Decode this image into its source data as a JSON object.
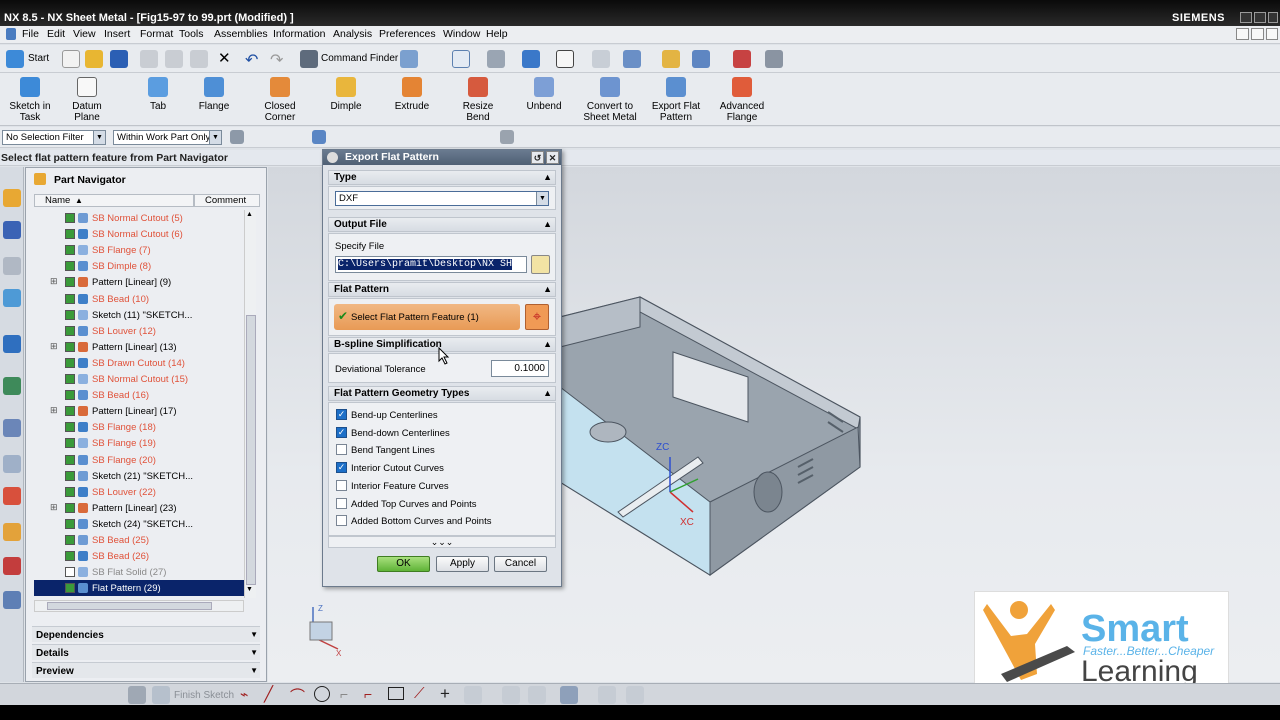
{
  "window": {
    "title": "NX 8.5 - NX Sheet Metal - [Fig15-97 to 99.prt (Modified) ]",
    "brand": "SIEMENS"
  },
  "menu": [
    "File",
    "Edit",
    "View",
    "Insert",
    "Format",
    "Tools",
    "Assemblies",
    "Information",
    "Analysis",
    "Preferences",
    "Window",
    "Help"
  ],
  "toolbar": {
    "start_label": "Start",
    "command_finder_label": "Command Finder"
  },
  "ribbon": [
    {
      "label": "Sketch in Task",
      "icon": "sketch-icon"
    },
    {
      "label": "Datum Plane",
      "icon": "datum-plane-icon"
    },
    {
      "label": "Tab",
      "icon": "tab-icon"
    },
    {
      "label": "Flange",
      "icon": "flange-icon"
    },
    {
      "label": "Closed Corner",
      "icon": "closed-corner-icon"
    },
    {
      "label": "Dimple",
      "icon": "dimple-icon"
    },
    {
      "label": "Extrude",
      "icon": "extrude-icon"
    },
    {
      "label": "Resize Bend",
      "icon": "resize-bend-icon"
    },
    {
      "label": "Unbend",
      "icon": "unbend-icon"
    },
    {
      "label": "Convert to Sheet Metal",
      "icon": "convert-icon"
    },
    {
      "label": "Export Flat Pattern",
      "icon": "export-flat-icon"
    },
    {
      "label": "Advanced Flange",
      "icon": "advanced-flange-icon"
    }
  ],
  "filters": {
    "selection_filter": "No Selection Filter",
    "scope": "Within Work Part Only"
  },
  "cue_line": "Select flat pattern feature from Part Navigator",
  "navigator": {
    "title": "Part Navigator",
    "columns": [
      "Name",
      "Comment"
    ],
    "rows": [
      {
        "label": "SB Normal Cutout (5)",
        "style": "red",
        "checked": true
      },
      {
        "label": "SB Normal Cutout (6)",
        "style": "red",
        "checked": true
      },
      {
        "label": "SB Flange (7)",
        "style": "red",
        "checked": true
      },
      {
        "label": "SB Dimple (8)",
        "style": "red",
        "checked": true
      },
      {
        "label": "Pattern [Linear] (9)",
        "style": "normal",
        "checked": true,
        "expand": true
      },
      {
        "label": "SB Bead (10)",
        "style": "red",
        "checked": true
      },
      {
        "label": "Sketch (11) \"SKETCH...",
        "style": "normal",
        "checked": true
      },
      {
        "label": "SB Louver (12)",
        "style": "red",
        "checked": true
      },
      {
        "label": "Pattern [Linear] (13)",
        "style": "normal",
        "checked": true,
        "expand": true
      },
      {
        "label": "SB Drawn Cutout (14)",
        "style": "red",
        "checked": true
      },
      {
        "label": "SB Normal Cutout (15)",
        "style": "red",
        "checked": true
      },
      {
        "label": "SB Bead (16)",
        "style": "red",
        "checked": true
      },
      {
        "label": "Pattern [Linear] (17)",
        "style": "normal",
        "checked": true,
        "expand": true
      },
      {
        "label": "SB Flange (18)",
        "style": "red",
        "checked": true
      },
      {
        "label": "SB Flange (19)",
        "style": "red",
        "checked": true
      },
      {
        "label": "SB Flange (20)",
        "style": "red",
        "checked": true
      },
      {
        "label": "Sketch (21) \"SKETCH...",
        "style": "normal",
        "checked": true
      },
      {
        "label": "SB Louver (22)",
        "style": "red",
        "checked": true
      },
      {
        "label": "Pattern [Linear] (23)",
        "style": "normal",
        "checked": true,
        "expand": true
      },
      {
        "label": "Sketch (24) \"SKETCH...",
        "style": "normal",
        "checked": true
      },
      {
        "label": "SB Bead (25)",
        "style": "red",
        "checked": true
      },
      {
        "label": "SB Bead (26)",
        "style": "red",
        "checked": true
      },
      {
        "label": "SB Flat Solid (27)",
        "style": "gray",
        "checked": false
      },
      {
        "label": "Flat Pattern (29)",
        "style": "selected",
        "checked": true
      }
    ],
    "sections": [
      "Dependencies",
      "Details",
      "Preview"
    ]
  },
  "dialog": {
    "title": "Export Flat Pattern",
    "type_section": "Type",
    "type_value": "DXF",
    "output_section": "Output File",
    "specify_file_label": "Specify File",
    "file_path": "C:\\Users\\pramit\\Desktop\\NX SH",
    "flat_section": "Flat Pattern",
    "select_label": "Select Flat Pattern Feature (1)",
    "bspline_section": "B-spline Simplification",
    "tolerance_label": "Deviational Tolerance",
    "tolerance_value": "0.1000",
    "geometry_section": "Flat Pattern Geometry Types",
    "options": [
      {
        "label": "Bend-up Centerlines",
        "checked": true
      },
      {
        "label": "Bend-down Centerlines",
        "checked": true
      },
      {
        "label": "Bend Tangent Lines",
        "checked": false
      },
      {
        "label": "Interior Cutout Curves",
        "checked": true
      },
      {
        "label": "Interior Feature Curves",
        "checked": false
      },
      {
        "label": "Added Top Curves and Points",
        "checked": false
      },
      {
        "label": "Added Bottom Curves and Points",
        "checked": false
      }
    ],
    "ok": "OK",
    "apply": "Apply",
    "cancel": "Cancel"
  },
  "viewport": {
    "axis_zc": "ZC",
    "axis_xc": "XC",
    "triad_z": "Z",
    "triad_x": "X"
  },
  "bottom_toolbar": {
    "finish_sketch": "Finish Sketch"
  },
  "watermark": {
    "brand": "Smart",
    "tagline": "Faster...Better...Cheaper",
    "product": "Learning"
  },
  "colors": {
    "accent_red": "#e0523a",
    "selected_row": "#0a246a",
    "ok_green": "#5fb337",
    "select_step": "#e89a55"
  }
}
